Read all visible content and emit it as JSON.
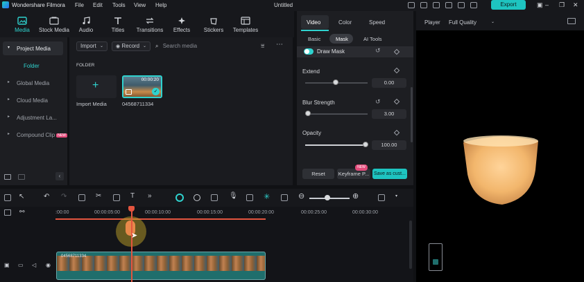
{
  "titlebar": {
    "app_name": "Wondershare Filmora",
    "menu": [
      "File",
      "Edit",
      "Tools",
      "View",
      "Help"
    ],
    "doc_title": "Untitled",
    "export_label": "Export"
  },
  "media_toolbar": {
    "tools": [
      "Media",
      "Stock Media",
      "Audio",
      "Titles",
      "Transitions",
      "Effects",
      "Stickers",
      "Templates"
    ]
  },
  "left_panel": {
    "items": [
      "Project Media",
      "Folder",
      "Global Media",
      "Cloud Media",
      "Adjustment La...",
      "Compound Clip"
    ],
    "new_badge": "NEW"
  },
  "media_area": {
    "import_label": "Import",
    "record_label": "Record",
    "search_placeholder": "Search media",
    "folder_heading": "FOLDER",
    "import_media_label": "Import Media",
    "clip_name": "04568711334",
    "clip_duration": "00:00:20"
  },
  "property_panel": {
    "tabs": [
      "Video",
      "Color",
      "Speed"
    ],
    "subtabs": [
      "Basic",
      "Mask",
      "AI Tools"
    ],
    "draw_mask": "Draw Mask",
    "extend_label": "Extend",
    "extend_value": "0.00",
    "blur_label": "Blur Strength",
    "blur_value": "3.00",
    "opacity_label": "Opacity",
    "opacity_value": "100.00",
    "reset_label": "Reset",
    "keyframe_label": "Keyframe P...",
    "save_label": "Save as cust...",
    "new_tag": "NEW"
  },
  "player": {
    "label": "Player",
    "quality": "Full Quality"
  },
  "timeline": {
    "ticks": [
      ":00:00",
      "00:00:05:00",
      "00:00:10:00",
      "00:00:15:00",
      "00:00:20:00",
      "00:00:25:00",
      "00:00:30:00"
    ],
    "clip_label": "04568711334"
  },
  "colors": {
    "accent": "#1ec4c0",
    "playhead": "#e4553f",
    "badge": "#e34b7b"
  }
}
